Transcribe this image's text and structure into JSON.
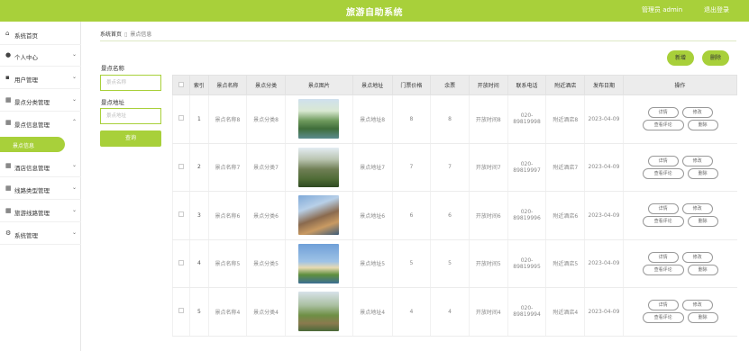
{
  "topbar": {
    "title": "旅游自助系统",
    "user": "管理员 admin",
    "logout": "退出登录"
  },
  "sidebar": {
    "items": [
      {
        "label": "系统首页",
        "icon": "home-icon"
      },
      {
        "label": "个人中心",
        "icon": "user-icon"
      },
      {
        "label": "用户管理",
        "icon": "users-icon"
      },
      {
        "label": "景点分类管理",
        "icon": "grid-icon"
      },
      {
        "label": "景点信息管理",
        "icon": "grid-icon"
      },
      {
        "label": "酒店信息管理",
        "icon": "grid-icon"
      },
      {
        "label": "线路类型管理",
        "icon": "grid-icon"
      },
      {
        "label": "旅游线路管理",
        "icon": "grid-icon"
      },
      {
        "label": "系统管理",
        "icon": "gear-icon"
      }
    ],
    "active_sub": "景点信息"
  },
  "breadcrumb": {
    "home": "系统首页",
    "current": "景点信息"
  },
  "search": {
    "name_label": "景点名称",
    "name_placeholder": "景点名称",
    "addr_label": "景点地址",
    "addr_placeholder": "景点地址",
    "button": "查询"
  },
  "actions": {
    "add": "新增",
    "delete": "删除"
  },
  "table": {
    "headers": [
      "",
      "索引",
      "景点名称",
      "景点分类",
      "景点图片",
      "景点地址",
      "门票价格",
      "余票",
      "开放时间",
      "联系电话",
      "附近酒店",
      "发布日期",
      "操作"
    ],
    "ops": {
      "detail": "详情",
      "edit": "修改",
      "comments": "查看评论",
      "delete": "删除"
    },
    "rows": [
      {
        "index": "1",
        "name": "景点名称8",
        "category": "景点分类8",
        "address": "景点地址8",
        "price": "8",
        "tickets": "8",
        "open": "开放时间8",
        "phone": "020-89819998",
        "hotel": "附近酒店8",
        "date": "2023-04-09",
        "img": "img-karst"
      },
      {
        "index": "2",
        "name": "景点名称7",
        "category": "景点分类7",
        "address": "景点地址7",
        "price": "7",
        "tickets": "7",
        "open": "开放时间7",
        "phone": "020-89819997",
        "hotel": "附近酒店7",
        "date": "2023-04-09",
        "img": "img-pillars"
      },
      {
        "index": "3",
        "name": "景点名称6",
        "category": "景点分类6",
        "address": "景点地址6",
        "price": "6",
        "tickets": "6",
        "open": "开放时间6",
        "phone": "020-89819996",
        "hotel": "附近酒店6",
        "date": "2023-04-09",
        "img": "img-mountain"
      },
      {
        "index": "4",
        "name": "景点名称5",
        "category": "景点分类5",
        "address": "景点地址5",
        "price": "5",
        "tickets": "5",
        "open": "开放时间5",
        "phone": "020-89819995",
        "hotel": "附近酒店5",
        "date": "2023-04-09",
        "img": "img-tower"
      },
      {
        "index": "5",
        "name": "景点名称4",
        "category": "景点分类4",
        "address": "景点地址4",
        "price": "4",
        "tickets": "4",
        "open": "开放时间4",
        "phone": "020-89819994",
        "hotel": "附近酒店4",
        "date": "2023-04-09",
        "img": "img-river"
      }
    ]
  },
  "colors": {
    "accent": "#a8d03a",
    "header_bg": "#ececec"
  }
}
